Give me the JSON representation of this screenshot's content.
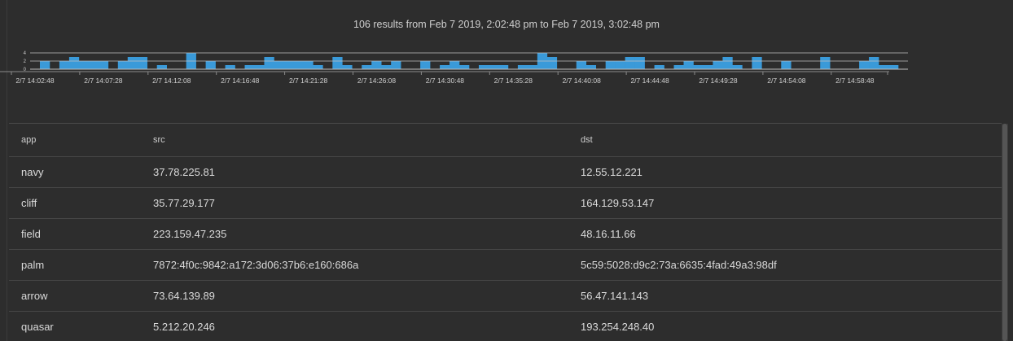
{
  "summary": {
    "count": "106",
    "text": "106 results from Feb 7 2019, 2:02:48 pm to Feb 7 2019, 3:02:48 pm"
  },
  "colors": {
    "background": "#2d2d2d",
    "bar": "#3a9ad9",
    "gridline": "#bfbfbf",
    "text": "#d8d8d8"
  },
  "chart_data": {
    "type": "bar",
    "x_tick_labels": [
      "2/7 14:02:48",
      "2/7 14:07:28",
      "2/7 14:12:08",
      "2/7 14:16:48",
      "2/7 14:21:28",
      "2/7 14:26:08",
      "2/7 14:30:48",
      "2/7 14:35:28",
      "2/7 14:40:08",
      "2/7 14:44:48",
      "2/7 14:49:28",
      "2/7 14:54:08",
      "2/7 14:58:48"
    ],
    "y_tick_labels": [
      "4",
      "2",
      "0"
    ],
    "ylim": [
      0,
      4
    ],
    "grid": true,
    "values": [
      0,
      2,
      0,
      2,
      3,
      2,
      2,
      2,
      0,
      2,
      3,
      3,
      0,
      1,
      0,
      0,
      4,
      0,
      2,
      0,
      1,
      0,
      1,
      1,
      3,
      2,
      2,
      2,
      2,
      1,
      0,
      3,
      1,
      0,
      1,
      2,
      1,
      2,
      0,
      0,
      2,
      0,
      1,
      2,
      1,
      0,
      1,
      1,
      1,
      0,
      1,
      1,
      4,
      3,
      0,
      0,
      2,
      1,
      0,
      2,
      2,
      3,
      3,
      0,
      1,
      0,
      1,
      2,
      1,
      1,
      2,
      3,
      1,
      0,
      3,
      0,
      0,
      2,
      0,
      0,
      0,
      3,
      0,
      0,
      0,
      2,
      3,
      1,
      1,
      0
    ]
  },
  "table": {
    "columns": [
      {
        "key": "app",
        "label": "app"
      },
      {
        "key": "src",
        "label": "src"
      },
      {
        "key": "dst",
        "label": "dst"
      }
    ],
    "rows": [
      {
        "app": "navy",
        "src": "37.78.225.81",
        "dst": "12.55.12.221"
      },
      {
        "app": "cliff",
        "src": "35.77.29.177",
        "dst": "164.129.53.147"
      },
      {
        "app": "field",
        "src": "223.159.47.235",
        "dst": "48.16.11.66"
      },
      {
        "app": "palm",
        "src": "7872:4f0c:9842:a172:3d06:37b6:e160:686a",
        "dst": "5c59:5028:d9c2:73a:6635:4fad:49a3:98df"
      },
      {
        "app": "arrow",
        "src": "73.64.139.89",
        "dst": "56.47.141.143"
      },
      {
        "app": "quasar",
        "src": "5.212.20.246",
        "dst": "193.254.248.40"
      }
    ]
  }
}
